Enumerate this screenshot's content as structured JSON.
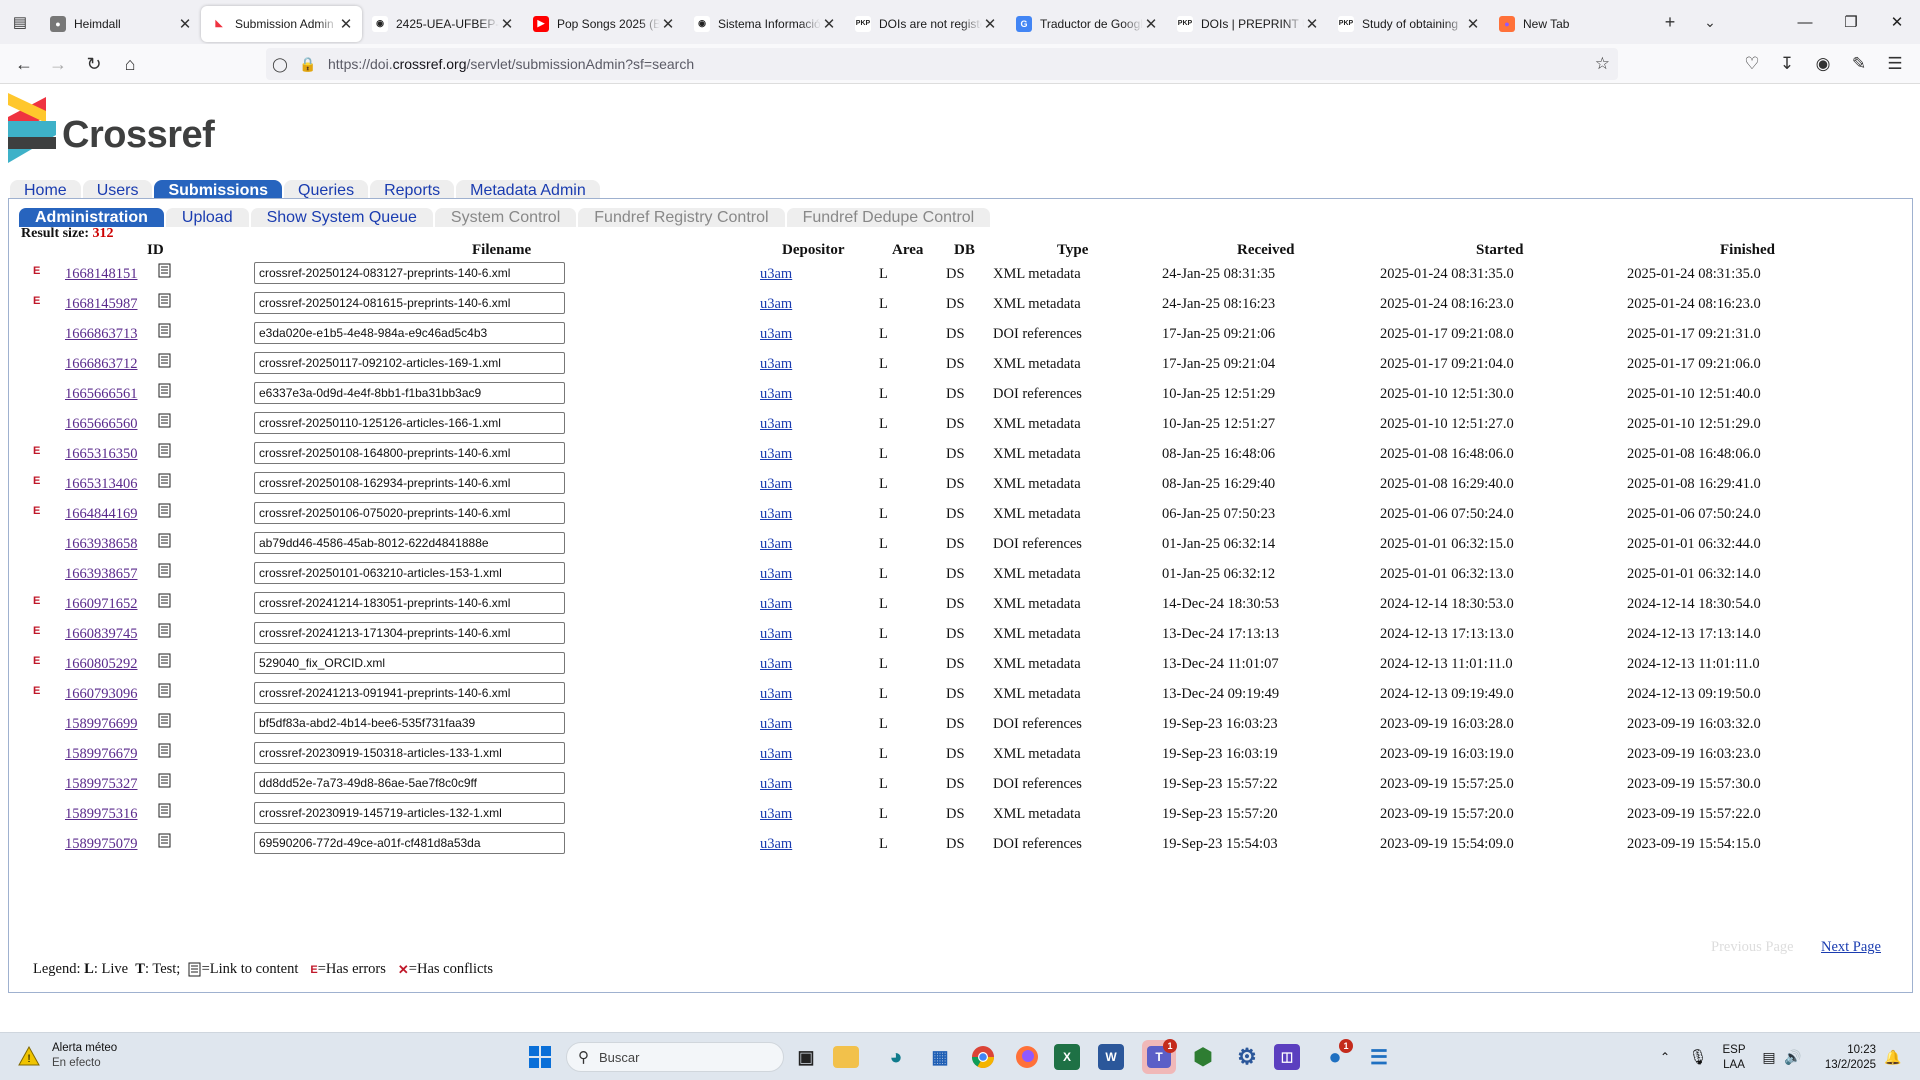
{
  "browser": {
    "tabs": [
      {
        "title": "Heimdall",
        "favicon": "globe-gray",
        "active": false
      },
      {
        "title": "Submission Admin",
        "favicon": "crossref",
        "active": true
      },
      {
        "title": "2425-UEA-UFBEP-0",
        "favicon": "github",
        "active": false
      },
      {
        "title": "Pop Songs 2025 (Be",
        "favicon": "youtube",
        "active": false
      },
      {
        "title": "Sistema Información",
        "favicon": "github",
        "active": false
      },
      {
        "title": "DOIs are not registe",
        "favicon": "pkp",
        "active": false
      },
      {
        "title": "Traductor de Googl",
        "favicon": "google-translate",
        "active": false
      },
      {
        "title": "DOIs | PREPRINT UE",
        "favicon": "pkp",
        "active": false
      },
      {
        "title": "Study of obtaining",
        "favicon": "pkp",
        "active": false
      },
      {
        "title": "New Tab",
        "favicon": "firefox",
        "active": false
      }
    ],
    "url_prefix": "https://doi.",
    "url_domain": "crossref.org",
    "url_suffix": "/servlet/submissionAdmin?sf=search"
  },
  "site": {
    "logo_text": "Crossref",
    "menu1": [
      {
        "label": "Home",
        "active": false
      },
      {
        "label": "Users",
        "active": false
      },
      {
        "label": "Submissions",
        "active": true
      },
      {
        "label": "Queries",
        "active": false
      },
      {
        "label": "Reports",
        "active": false
      },
      {
        "label": "Metadata Admin",
        "active": false
      }
    ],
    "menu2": [
      {
        "label": "Administration",
        "state": "active"
      },
      {
        "label": "Upload",
        "state": "normal"
      },
      {
        "label": "Show System Queue",
        "state": "normal"
      },
      {
        "label": "System Control",
        "state": "disabled"
      },
      {
        "label": "Fundref Registry Control",
        "state": "disabled"
      },
      {
        "label": "Fundref Dedupe Control",
        "state": "disabled"
      }
    ]
  },
  "results": {
    "label": "Result size:",
    "count": "312",
    "columns": {
      "id": "ID",
      "filename": "Filename",
      "depositor": "Depositor",
      "area": "Area",
      "db": "DB",
      "type": "Type",
      "received": "Received",
      "started": "Started",
      "finished": "Finished"
    },
    "rows": [
      {
        "err": true,
        "id": "1668148151",
        "file": "crossref-20250124-083127-preprints-140-6.xml",
        "dep": "u3am",
        "area": "L",
        "db": "DS",
        "type": "XML metadata",
        "received": "24-Jan-25 08:31:35",
        "started": "2025-01-24 08:31:35.0",
        "finished": "2025-01-24 08:31:35.0"
      },
      {
        "err": true,
        "id": "1668145987",
        "file": "crossref-20250124-081615-preprints-140-6.xml",
        "dep": "u3am",
        "area": "L",
        "db": "DS",
        "type": "XML metadata",
        "received": "24-Jan-25 08:16:23",
        "started": "2025-01-24 08:16:23.0",
        "finished": "2025-01-24 08:16:23.0"
      },
      {
        "err": false,
        "id": "1666863713",
        "file": "e3da020e-e1b5-4e48-984a-e9c46ad5c4b3",
        "dep": "u3am",
        "area": "L",
        "db": "DS",
        "type": "DOI references",
        "received": "17-Jan-25 09:21:06",
        "started": "2025-01-17 09:21:08.0",
        "finished": "2025-01-17 09:21:31.0"
      },
      {
        "err": false,
        "id": "1666863712",
        "file": "crossref-20250117-092102-articles-169-1.xml",
        "dep": "u3am",
        "area": "L",
        "db": "DS",
        "type": "XML metadata",
        "received": "17-Jan-25 09:21:04",
        "started": "2025-01-17 09:21:04.0",
        "finished": "2025-01-17 09:21:06.0"
      },
      {
        "err": false,
        "id": "1665666561",
        "file": "e6337e3a-0d9d-4e4f-8bb1-f1ba31bb3ac9",
        "dep": "u3am",
        "area": "L",
        "db": "DS",
        "type": "DOI references",
        "received": "10-Jan-25 12:51:29",
        "started": "2025-01-10 12:51:30.0",
        "finished": "2025-01-10 12:51:40.0"
      },
      {
        "err": false,
        "id": "1665666560",
        "file": "crossref-20250110-125126-articles-166-1.xml",
        "dep": "u3am",
        "area": "L",
        "db": "DS",
        "type": "XML metadata",
        "received": "10-Jan-25 12:51:27",
        "started": "2025-01-10 12:51:27.0",
        "finished": "2025-01-10 12:51:29.0"
      },
      {
        "err": true,
        "id": "1665316350",
        "file": "crossref-20250108-164800-preprints-140-6.xml",
        "dep": "u3am",
        "area": "L",
        "db": "DS",
        "type": "XML metadata",
        "received": "08-Jan-25 16:48:06",
        "started": "2025-01-08 16:48:06.0",
        "finished": "2025-01-08 16:48:06.0"
      },
      {
        "err": true,
        "id": "1665313406",
        "file": "crossref-20250108-162934-preprints-140-6.xml",
        "dep": "u3am",
        "area": "L",
        "db": "DS",
        "type": "XML metadata",
        "received": "08-Jan-25 16:29:40",
        "started": "2025-01-08 16:29:40.0",
        "finished": "2025-01-08 16:29:41.0"
      },
      {
        "err": true,
        "id": "1664844169",
        "file": "crossref-20250106-075020-preprints-140-6.xml",
        "dep": "u3am",
        "area": "L",
        "db": "DS",
        "type": "XML metadata",
        "received": "06-Jan-25 07:50:23",
        "started": "2025-01-06 07:50:24.0",
        "finished": "2025-01-06 07:50:24.0"
      },
      {
        "err": false,
        "id": "1663938658",
        "file": "ab79dd46-4586-45ab-8012-622d4841888e",
        "dep": "u3am",
        "area": "L",
        "db": "DS",
        "type": "DOI references",
        "received": "01-Jan-25 06:32:14",
        "started": "2025-01-01 06:32:15.0",
        "finished": "2025-01-01 06:32:44.0"
      },
      {
        "err": false,
        "id": "1663938657",
        "file": "crossref-20250101-063210-articles-153-1.xml",
        "dep": "u3am",
        "area": "L",
        "db": "DS",
        "type": "XML metadata",
        "received": "01-Jan-25 06:32:12",
        "started": "2025-01-01 06:32:13.0",
        "finished": "2025-01-01 06:32:14.0"
      },
      {
        "err": true,
        "id": "1660971652",
        "file": "crossref-20241214-183051-preprints-140-6.xml",
        "dep": "u3am",
        "area": "L",
        "db": "DS",
        "type": "XML metadata",
        "received": "14-Dec-24 18:30:53",
        "started": "2024-12-14 18:30:53.0",
        "finished": "2024-12-14 18:30:54.0"
      },
      {
        "err": true,
        "id": "1660839745",
        "file": "crossref-20241213-171304-preprints-140-6.xml",
        "dep": "u3am",
        "area": "L",
        "db": "DS",
        "type": "XML metadata",
        "received": "13-Dec-24 17:13:13",
        "started": "2024-12-13 17:13:13.0",
        "finished": "2024-12-13 17:13:14.0"
      },
      {
        "err": true,
        "id": "1660805292",
        "file": "529040_fix_ORCID.xml",
        "dep": "u3am",
        "area": "L",
        "db": "DS",
        "type": "XML metadata",
        "received": "13-Dec-24 11:01:07",
        "started": "2024-12-13 11:01:11.0",
        "finished": "2024-12-13 11:01:11.0"
      },
      {
        "err": true,
        "id": "1660793096",
        "file": "crossref-20241213-091941-preprints-140-6.xml",
        "dep": "u3am",
        "area": "L",
        "db": "DS",
        "type": "XML metadata",
        "received": "13-Dec-24 09:19:49",
        "started": "2024-12-13 09:19:49.0",
        "finished": "2024-12-13 09:19:50.0"
      },
      {
        "err": false,
        "id": "1589976699",
        "file": "bf5df83a-abd2-4b14-bee6-535f731faa39",
        "dep": "u3am",
        "area": "L",
        "db": "DS",
        "type": "DOI references",
        "received": "19-Sep-23 16:03:23",
        "started": "2023-09-19 16:03:28.0",
        "finished": "2023-09-19 16:03:32.0"
      },
      {
        "err": false,
        "id": "1589976679",
        "file": "crossref-20230919-150318-articles-133-1.xml",
        "dep": "u3am",
        "area": "L",
        "db": "DS",
        "type": "XML metadata",
        "received": "19-Sep-23 16:03:19",
        "started": "2023-09-19 16:03:19.0",
        "finished": "2023-09-19 16:03:23.0"
      },
      {
        "err": false,
        "id": "1589975327",
        "file": "dd8dd52e-7a73-49d8-86ae-5ae7f8c0c9ff",
        "dep": "u3am",
        "area": "L",
        "db": "DS",
        "type": "DOI references",
        "received": "19-Sep-23 15:57:22",
        "started": "2023-09-19 15:57:25.0",
        "finished": "2023-09-19 15:57:30.0"
      },
      {
        "err": false,
        "id": "1589975316",
        "file": "crossref-20230919-145719-articles-132-1.xml",
        "dep": "u3am",
        "area": "L",
        "db": "DS",
        "type": "XML metadata",
        "received": "19-Sep-23 15:57:20",
        "started": "2023-09-19 15:57:20.0",
        "finished": "2023-09-19 15:57:22.0"
      },
      {
        "err": false,
        "id": "1589975079",
        "file": "69590206-772d-49ce-a01f-cf481d8a53da",
        "dep": "u3am",
        "area": "L",
        "db": "DS",
        "type": "DOI references",
        "received": "19-Sep-23 15:54:03",
        "started": "2023-09-19 15:54:09.0",
        "finished": "2023-09-19 15:54:15.0"
      }
    ],
    "prev_page": "Previous Page",
    "next_page": "Next Page",
    "legend": {
      "prefix": "Legend: ",
      "live_key": "L",
      "live_text": ": Live  ",
      "test_key": "T",
      "test_text": ": Test;  ",
      "link_text": "=Link to content",
      "err_mark": "E",
      "err_text": "=Has errors",
      "conf_mark": "✕",
      "conf_text": "=Has conflicts"
    }
  },
  "taskbar": {
    "weather_title": "Alerta méteo",
    "weather_sub": "En efecto",
    "search_placeholder": "Buscar",
    "lang_line1": "ESP",
    "lang_line2": "LAA",
    "time": "10:23",
    "date": "13/2/2025",
    "teams_badge": "1",
    "app_badge": "1"
  },
  "colors": {
    "crossref_blue": "#2764be",
    "link_blue": "#1a3cb0",
    "visited_purple": "#5a2a8c",
    "error_red": "#c0182a"
  }
}
